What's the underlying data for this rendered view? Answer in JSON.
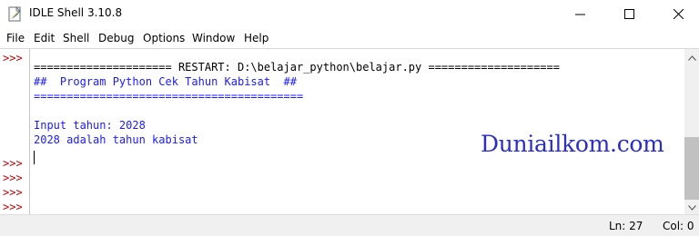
{
  "window": {
    "title": "IDLE Shell 3.10.8",
    "app_icon": "python-feather-icon",
    "controls": [
      "minimize-icon",
      "maximize-icon",
      "close-icon"
    ]
  },
  "menu": [
    "File",
    "Edit",
    "Shell",
    "Debug",
    "Options",
    "Window",
    "Help"
  ],
  "shell": {
    "prompt": ">>>",
    "lines": [
      "===================== RESTART: D:\\belajar_python\\belajar.py ====================",
      "##  Program Python Cek Tahun Kabisat  ##",
      "=========================================",
      "",
      "Input tahun: 2028",
      "2028 adalah tahun kabisat"
    ]
  },
  "watermark": "Duniailkom.com",
  "status": {
    "line": "Ln: 27",
    "col": "Col: 0"
  },
  "colors": {
    "prompt": "#c00000",
    "comment": "#1a1aff",
    "output": "#1a1aff",
    "watermark": "#2b2ec2"
  }
}
